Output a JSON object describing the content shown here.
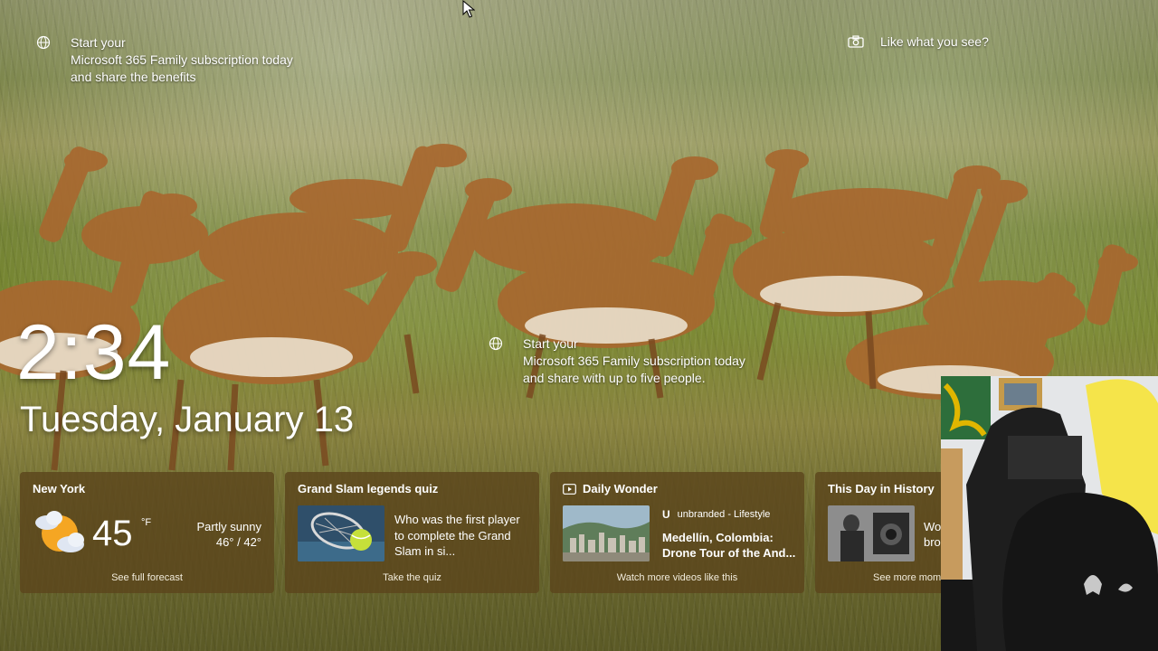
{
  "promo_top": {
    "line1": "Start your",
    "line2": "Microsoft 365 Family subscription today",
    "line3": "and share the benefits"
  },
  "promo_mid": {
    "line1": "Start your",
    "line2": "Microsoft 365 Family subscription today",
    "line3": "and share with up to five people."
  },
  "like_see": "Like what you see?",
  "clock": {
    "time": "2:34",
    "date": "Tuesday, January 13"
  },
  "cards": {
    "weather": {
      "title": "New York",
      "temp": "45",
      "unit": "°F",
      "condition": "Partly sunny",
      "range": "46° / 42°",
      "footer": "See full forecast"
    },
    "quiz": {
      "title": "Grand Slam legends quiz",
      "line1": "Who was the first player",
      "line2": "to complete the Grand",
      "line3": "Slam in si...",
      "footer": "Take the quiz"
    },
    "wonder": {
      "title": "Daily Wonder",
      "source_mark": "U",
      "source": "unbranded - Lifestyle",
      "headline1": "Medellín, Colombia:",
      "headline2": "Drone Tour of the And...",
      "footer": "Watch more videos like this"
    },
    "history": {
      "title": "This Day in History",
      "partial1": "Wo",
      "partial2": "bro",
      "footer": "See more mom"
    }
  },
  "colors": {
    "card_bg": "#5c461c",
    "text": "#ffffff",
    "sun": "#f5a623"
  },
  "icons": [
    "globe-icon",
    "camera-icon",
    "partly-sunny-icon",
    "video-icon",
    "cursor-icon"
  ]
}
